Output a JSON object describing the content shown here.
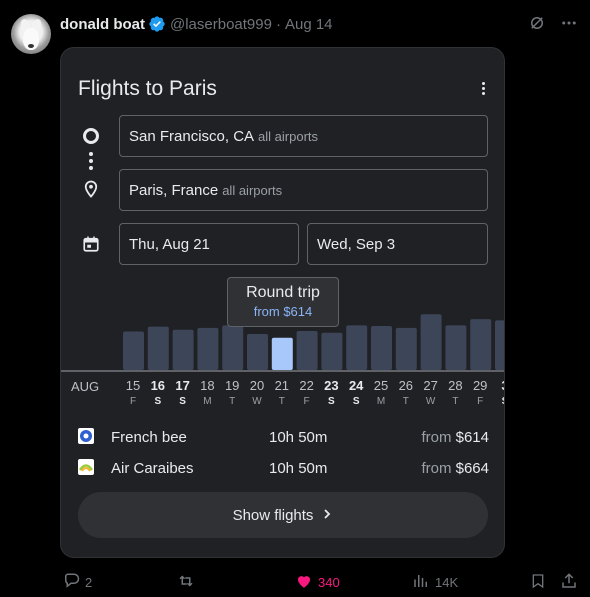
{
  "tweet": {
    "display_name": "donald boat",
    "handle": "@laserboat999",
    "separator": "·",
    "date": "Aug 14"
  },
  "card": {
    "title": "Flights to Paris",
    "origin": {
      "city": "San Francisco, CA",
      "sub": "all airports"
    },
    "destination": {
      "city": "Paris, France",
      "sub": "all airports"
    },
    "depart_date": "Thu, Aug 21",
    "return_date": "Wed, Sep 3",
    "tooltip": {
      "line1": "Round trip",
      "line2": "from $614"
    },
    "month_label": "AUG",
    "days": [
      {
        "num": "15",
        "wd": "F",
        "bold": false
      },
      {
        "num": "16",
        "wd": "S",
        "bold": true
      },
      {
        "num": "17",
        "wd": "S",
        "bold": true
      },
      {
        "num": "18",
        "wd": "M",
        "bold": false
      },
      {
        "num": "19",
        "wd": "T",
        "bold": false
      },
      {
        "num": "20",
        "wd": "W",
        "bold": false
      },
      {
        "num": "21",
        "wd": "T",
        "bold": false
      },
      {
        "num": "22",
        "wd": "F",
        "bold": false
      },
      {
        "num": "23",
        "wd": "S",
        "bold": true
      },
      {
        "num": "24",
        "wd": "S",
        "bold": true
      },
      {
        "num": "25",
        "wd": "M",
        "bold": false
      },
      {
        "num": "26",
        "wd": "T",
        "bold": false
      },
      {
        "num": "27",
        "wd": "W",
        "bold": false
      },
      {
        "num": "28",
        "wd": "T",
        "bold": false
      },
      {
        "num": "29",
        "wd": "F",
        "bold": false
      },
      {
        "num": "3",
        "wd": "S",
        "bold": true
      }
    ],
    "price_bars": {
      "relative_heights": [
        0.62,
        0.7,
        0.65,
        0.68,
        0.72,
        0.58,
        0.52,
        0.63,
        0.6,
        0.72,
        0.71,
        0.68,
        0.9,
        0.72,
        0.82,
        0.8
      ],
      "selected_index": 6
    },
    "flights": [
      {
        "airline": "French bee",
        "duration": "10h 50m",
        "from": "from",
        "price": "$614",
        "logo_color": "#2f5fd0"
      },
      {
        "airline": "Air Caraibes",
        "duration": "10h 50m",
        "from": "from",
        "price": "$664",
        "logo_color": "#9ccc3d"
      }
    ],
    "show_button": "Show flights"
  },
  "actions": {
    "replies": "2",
    "likes": "340",
    "views": "14K"
  },
  "colors": {
    "bar": "#3c4658",
    "bar_selected": "#a8c7fa",
    "like": "#f91880",
    "verified": "#1d9bf0"
  }
}
